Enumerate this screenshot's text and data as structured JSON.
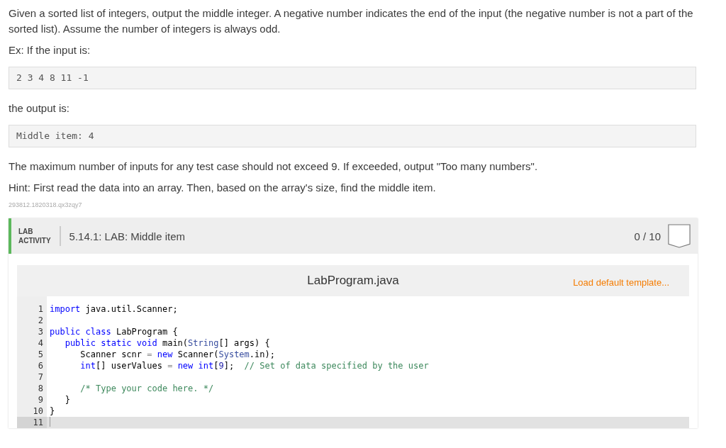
{
  "description": [
    {
      "kind": "text",
      "text": "Given a sorted list of integers, output the middle integer. A negative number indicates the end of the input (the negative number is not a part of the sorted list). Assume the number of integers is always odd."
    },
    {
      "kind": "text",
      "text": "Ex: If the input is:"
    },
    {
      "kind": "code",
      "text": "2 3 4 8 11 -1"
    },
    {
      "kind": "text",
      "text": "the output is:"
    },
    {
      "kind": "code",
      "text": "Middle item: 4"
    },
    {
      "kind": "text",
      "text": "The maximum number of inputs for any test case should not exceed 9. If exceeded, output \"Too many numbers\"."
    },
    {
      "kind": "text",
      "text": "Hint: First read the data into an array. Then, based on the array's size, find the middle item."
    },
    {
      "kind": "id",
      "text": "293812.1820318.qx3zqy7"
    }
  ],
  "lab": {
    "label_top": "LAB",
    "label_bottom": "ACTIVITY",
    "title": "5.14.1: LAB: Middle item",
    "score": "0 / 10"
  },
  "editor": {
    "filename": "LabProgram.java",
    "template_link": "Load default template...",
    "lines": [
      {
        "number": "1",
        "active": false,
        "tokens": [
          {
            "kind": "keyword",
            "text": "import"
          },
          {
            "kind": "plain",
            "text": " java.util.Scanner;"
          }
        ]
      },
      {
        "number": "2",
        "active": false
      },
      {
        "number": "3",
        "active": false,
        "tokens": [
          {
            "kind": "keyword",
            "text": "public class"
          },
          {
            "kind": "plain",
            "text": " LabProgram {"
          }
        ]
      },
      {
        "number": "4",
        "active": false,
        "tokens": [
          {
            "kind": "keyword",
            "text": "   public static void"
          },
          {
            "kind": "plain",
            "text": " main("
          },
          {
            "kind": "type",
            "text": "String"
          },
          {
            "kind": "plain",
            "text": "[] args) {"
          }
        ]
      },
      {
        "number": "5",
        "active": false,
        "tokens": [
          {
            "kind": "plain",
            "text": "      Scanner scnr "
          },
          {
            "kind": "operator",
            "text": "="
          },
          {
            "kind": "keyword",
            "text": " new"
          },
          {
            "kind": "plain",
            "text": " Scanner("
          },
          {
            "kind": "type",
            "text": "System"
          },
          {
            "kind": "plain",
            "text": ".in);"
          }
        ]
      },
      {
        "number": "6",
        "active": false,
        "tokens": [
          {
            "kind": "keyword",
            "text": "      int"
          },
          {
            "kind": "plain",
            "text": "[] userValues "
          },
          {
            "kind": "operator",
            "text": "="
          },
          {
            "kind": "keyword",
            "text": " new int"
          },
          {
            "kind": "plain",
            "text": "["
          },
          {
            "kind": "number",
            "text": "9"
          },
          {
            "kind": "plain",
            "text": "];  "
          },
          {
            "kind": "comment",
            "text": "// Set of data specified by the user"
          }
        ]
      },
      {
        "number": "7",
        "active": false
      },
      {
        "number": "8",
        "active": false,
        "tokens": [
          {
            "kind": "comment",
            "text": "      /* Type your code here. */"
          }
        ]
      },
      {
        "number": "9",
        "active": false,
        "tokens": [
          {
            "kind": "plain",
            "text": "   }"
          }
        ]
      },
      {
        "number": "10",
        "active": false,
        "tokens": [
          {
            "kind": "plain",
            "text": "}"
          }
        ]
      },
      {
        "number": "11",
        "active": true
      }
    ]
  }
}
